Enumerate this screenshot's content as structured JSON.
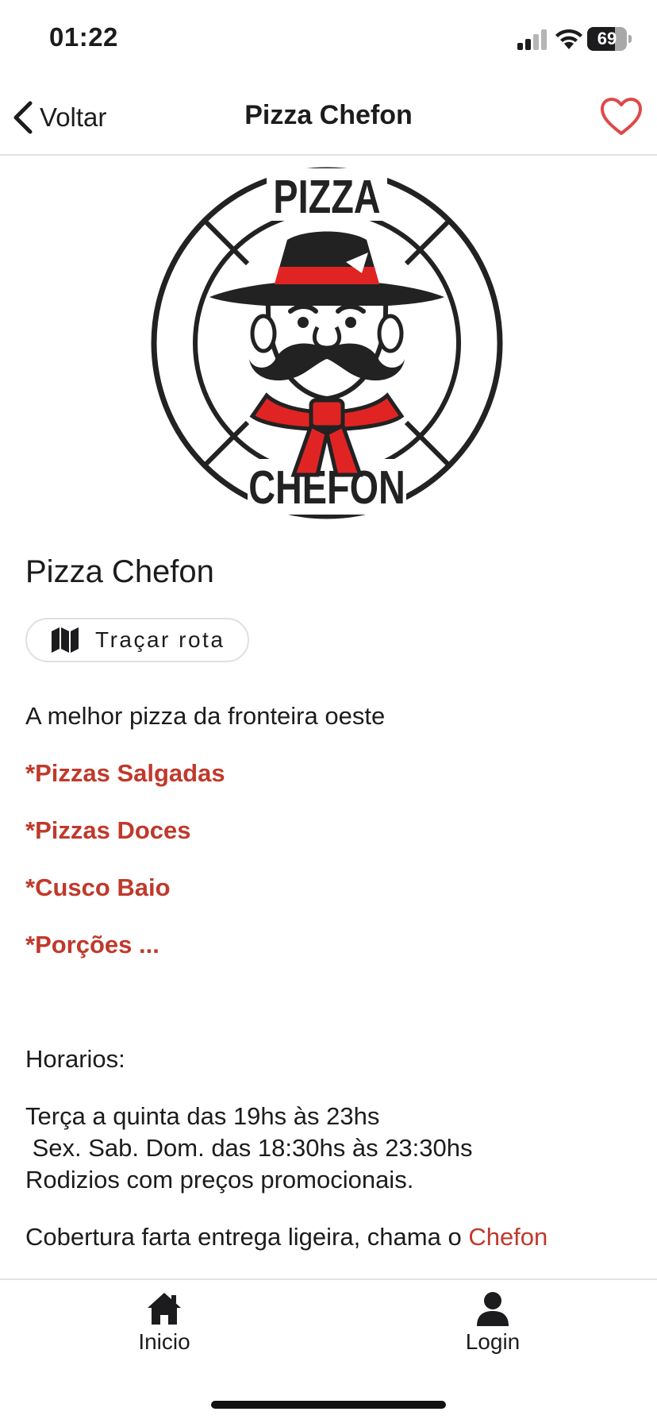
{
  "status_bar": {
    "time": "01:22",
    "battery_level": "69",
    "battery_fraction": 0.69
  },
  "nav": {
    "back_label": "Voltar",
    "title": "Pizza Chefon",
    "favorite_icon": "heart-outline-icon",
    "accent_color": "#e04848"
  },
  "logo": {
    "top_text": "PIZZA",
    "bottom_text": "CHEFON",
    "colors": {
      "ink": "#222222",
      "red": "#e02424"
    }
  },
  "store": {
    "name": "Pizza Chefon",
    "route_button_label": "Traçar rota",
    "route_icon": "map-icon"
  },
  "description": {
    "tagline": "A melhor pizza da fronteira oeste",
    "menu_highlights": [
      "*Pizzas Salgadas",
      "*Pizzas Doces",
      "*Cusco Baio",
      "*Porções ..."
    ],
    "hours_title": "Horarios:",
    "hours_lines": [
      "Terça a quinta das 19hs às 23hs",
      " Sex. Sab. Dom. das 18:30hs às 23:30hs",
      "Rodizios com preços promocionais."
    ],
    "closing_text": "Cobertura farta entrega ligeira, chama o ",
    "closing_link": "Chefon",
    "highlight_color": "#c0392b"
  },
  "tab_bar": {
    "tabs": [
      {
        "label": "Inicio",
        "icon": "home-icon"
      },
      {
        "label": "Login",
        "icon": "user-icon"
      }
    ]
  }
}
